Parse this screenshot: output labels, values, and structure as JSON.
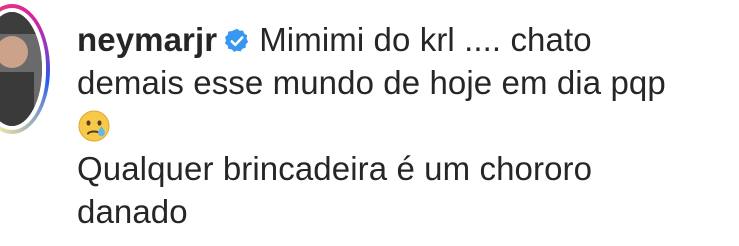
{
  "comment": {
    "username": "neymarjr",
    "verified": true,
    "text_line1": "Mimimi do krl .... chato",
    "text_line2": "demais esse mundo de hoje em dia pqp",
    "emoji": "😢",
    "text_line4": "Qualquer brincadeira é um chororo",
    "text_line5": "danado"
  },
  "icons": {
    "verified": "verified-badge-icon",
    "emoji": "crying-face-emoji"
  },
  "colors": {
    "text": "#262626",
    "verified_badge": "#3897f0",
    "avatar_ring_start": "#fd5949",
    "avatar_ring_end": "#d6249f"
  }
}
